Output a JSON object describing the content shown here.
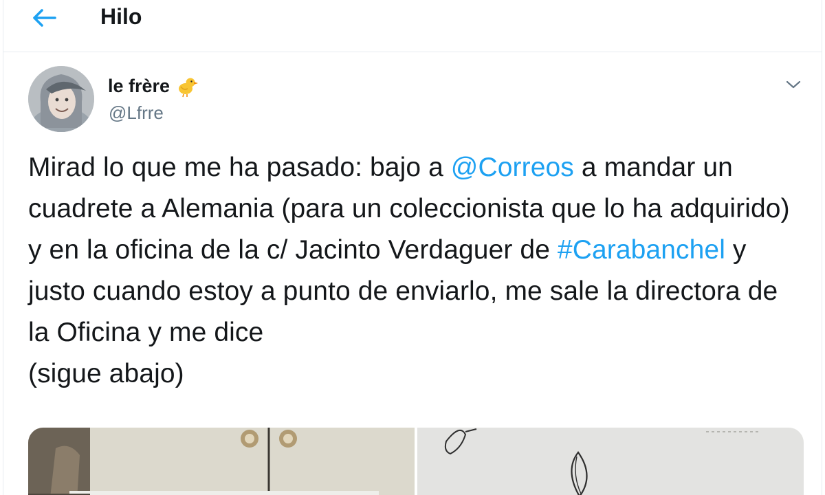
{
  "header": {
    "title": "Hilo",
    "back_icon": "arrow-left-icon"
  },
  "tweet": {
    "display_name": "le frère",
    "name_emoji": "baby-chick-icon",
    "handle": "@Lfrre",
    "text": {
      "p1": "Mirad lo que me ha pasado: bajo a ",
      "mention": "@Correos",
      "p2": " a mandar un cuadrete a Alemania (para un coleccionista que lo ha adquirido) y en la oficina de la c/ Jacinto Verdaguer de ",
      "hashtag": "#Carabanchel",
      "p3": " y justo cuando estoy a punto de enviarlo, me sale la directora de la Oficina y me dice",
      "p4": "(sigue abajo)"
    },
    "menu_icon": "chevron-down-icon",
    "media": [
      "photo-1",
      "photo-2"
    ]
  },
  "colors": {
    "accent": "#1da1f2",
    "text": "#14171a",
    "secondary": "#657786",
    "border": "#e6ecf0"
  }
}
